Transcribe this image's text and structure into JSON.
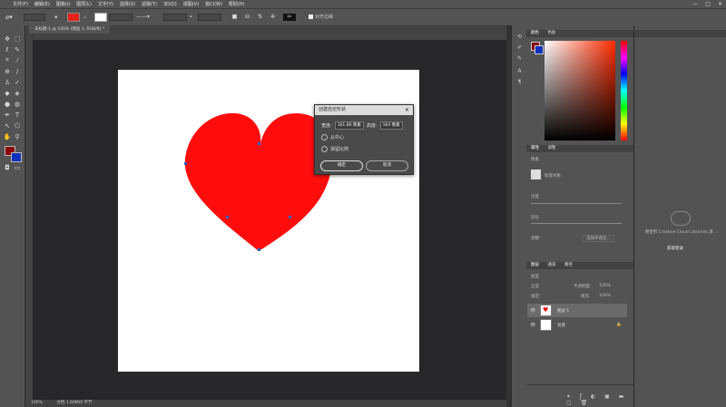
{
  "menubar": {
    "items": [
      "文件(F)",
      "编辑(E)",
      "图像(I)",
      "图层(L)",
      "文字(Y)",
      "选择(S)",
      "滤镜(T)",
      "3D(D)",
      "视图(V)",
      "窗口(W)",
      "帮助(H)"
    ],
    "window_controls": [
      "—",
      "□",
      "✕"
    ]
  },
  "options": {
    "fill_color": "#e8201a",
    "align_edges_label": "对齐边缘"
  },
  "document": {
    "tab_title": "未标题-1 @ 100% (图层 1, RGB/8) *",
    "zoom": "100%",
    "status": "文档:1.60M/0 字节"
  },
  "heart": {
    "color": "#ff0d0d"
  },
  "dialog": {
    "title": "创建自定形状",
    "width_label": "宽度:",
    "width_value": "161.86 像素",
    "height_label": "高度:",
    "height_value": "164 像素",
    "from_center": "从中心",
    "keep_ratio": "保留比例",
    "ok": "确定",
    "cancel": "取消"
  },
  "color_panel": {
    "tabs": [
      "颜色",
      "色板"
    ],
    "fg": "#8b0000",
    "bg": "#1030c0"
  },
  "properties_panel": {
    "tabs": [
      "属性",
      "调整"
    ],
    "type_label": "像素",
    "item_label": "智能对象",
    "density_label": "浓度",
    "feather_label": "羽化",
    "refine_label": "调整:",
    "select_mask_button": "选择并遮住..."
  },
  "layers_panel": {
    "tabs": [
      "图层",
      "通道",
      "路径"
    ],
    "kind_label": "类型",
    "blend_mode": "正常",
    "opacity_label": "不透明度:",
    "opacity_value": "100%",
    "lock_label": "锁定:",
    "fill_label": "填充:",
    "fill_value": "100%",
    "layers": [
      {
        "name": "图层 1"
      },
      {
        "name": "背景"
      }
    ]
  },
  "far_right": {
    "libraries_message": "要使用 Creative Cloud Libraries,请 ...",
    "libraries_link": "获取登录"
  }
}
